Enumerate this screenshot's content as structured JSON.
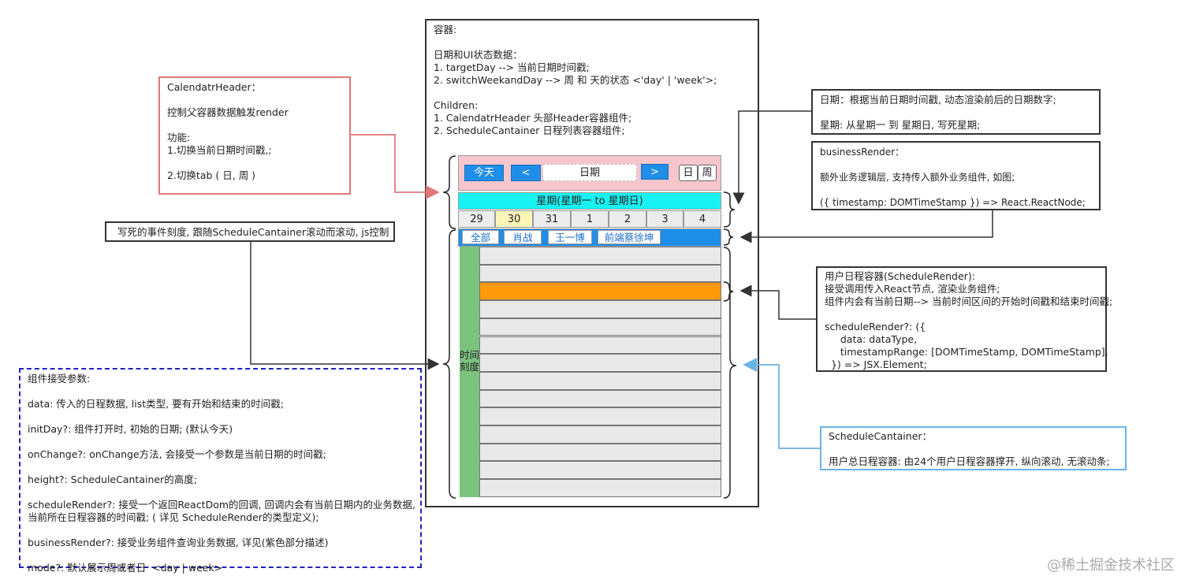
{
  "container": {
    "lines": [
      "容器:",
      "",
      "日期和UI状态数据：",
      "1. targetDay --> 当前日期时间戳;",
      "2. switchWeekandDay --> 周 和 天的状态 <'day' | 'week'>;",
      "",
      "Children:",
      "1. CalendatrHeader 头部Header容器组件;",
      "2. ScheduleCantainer 日程列表容器组件;"
    ]
  },
  "header": {
    "today_label": "今天",
    "prev_label": "<",
    "date_label": "日期",
    "next_label": ">",
    "tab_day": "日",
    "tab_week": "周"
  },
  "week": {
    "title": "星期(星期一 to 星期日)",
    "days": [
      "29",
      "30",
      "31",
      "1",
      "2",
      "3",
      "4"
    ]
  },
  "users": [
    "全部",
    "肖战",
    "王一博",
    "前端蔡徐坤"
  ],
  "time_scale_label": "时间刻度",
  "annotations": {
    "calendar_header": [
      "CalendatrHeader：",
      "",
      "控制父容器数据触发render",
      "",
      "功能:",
      "1.切换当前日期时间戳,;",
      "",
      "2.切换tab ( 日, 周 )"
    ],
    "fixed_scale": "写死的事件刻度, 跟随ScheduleCantainer滚动而滚动, js控制",
    "props": [
      "组件接受参数:",
      "",
      "data: 传入的日程数据, list类型, 要有开始和结束的时间戳;",
      "",
      "initDay?: 组件打开时, 初始的日期; (默认今天)",
      "",
      "onChange?: onChange方法, 会接受一个参数是当前日期的时间戳;",
      "",
      "height?: ScheduleCantainer的高度;",
      "",
      "scheduleRender?: 接受一个返回ReactDom的回调, 回调内会有当前日期内的业务数据,",
      "当前所在日程容器的时间戳; ( 详见 ScheduleRender的类型定义);",
      "",
      "businessRender?: 接受业务组件查询业务数据, 详见(紫色部分描述)",
      "",
      "mode?: 默认展示周或者日  <day | week>"
    ],
    "date_info": [
      "日期：根据当前日期时间戳, 动态渲染前后的日期数字;",
      "",
      "星期: 从星期一 到 星期日, 写死星期;"
    ],
    "business_render": [
      "businessRender：",
      "",
      "额外业务逻辑层, 支持传入额外业务组件, 如图;",
      "",
      "({ timestamp: DOMTimeStamp }) => React.ReactNode;"
    ],
    "user_schedule": [
      "用户日程容器(ScheduleRender):",
      "接受调用传入React节点, 渲染业务组件;",
      "组件内会有当前日期--> 当前时间区间的开始时间戳和结束时间戳;",
      "",
      "scheduleRender?: ({",
      "     data: dataType,",
      "     timestampRange: [DOMTimeStamp, DOMTimeStamp],",
      "  }) => JSX.Element;"
    ],
    "schedule_container": [
      "ScheduleCantainer：",
      "",
      "用户总日程容器: 由24个用户日程容器撑开, 纵向滚动, 无滚动条;"
    ]
  },
  "watermark": "@稀土掘金技术社区",
  "colors": {
    "header_bg": "#f7c6cd",
    "week_bg": "#19f2f2",
    "blue": "#1f8ee8",
    "highlight_row": "#ff9a0a",
    "time_col": "#7cc27f",
    "red_arrow": "#e07777",
    "blue_arrow": "#6ab4e6",
    "dashed_border": "#2222bb"
  }
}
